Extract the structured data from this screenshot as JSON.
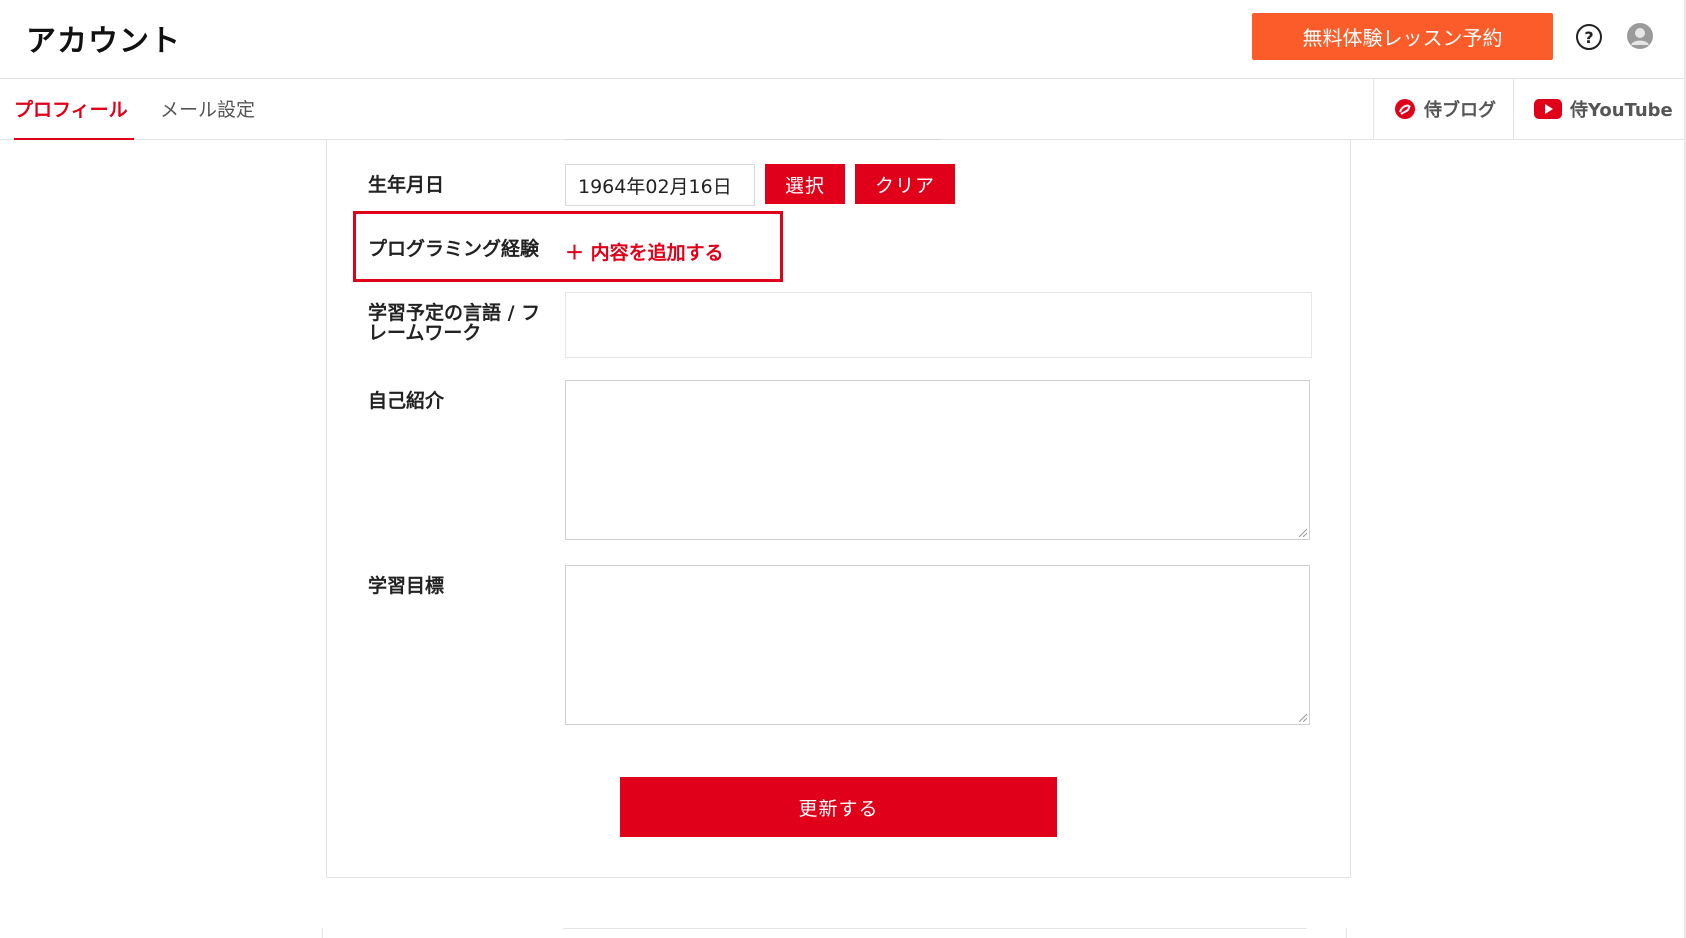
{
  "header": {
    "title": "アカウント",
    "trial_button": "無料体験レッスン予約",
    "help_icon": "?",
    "accent_color": "#fb5c29"
  },
  "tabs": {
    "profile": "プロフィール",
    "mail": "メール設定"
  },
  "external_links": {
    "blog": "侍ブログ",
    "youtube": "侍YouTube"
  },
  "form": {
    "birthday_label": "生年月日",
    "birthday_value": "1964年02月16日",
    "select_button": "選択",
    "clear_button": "クリア",
    "programming_label": "プログラミング経験",
    "add_content": "＋ 内容を追加する",
    "languages_label_1": "学習予定の言語 / フ",
    "languages_label_2": "レームワーク",
    "intro_label": "自己紹介",
    "goal_label": "学習目標",
    "update_button": "更新する"
  },
  "colors": {
    "brand_red": "#e0001a",
    "trial_orange": "#fb5c29"
  }
}
